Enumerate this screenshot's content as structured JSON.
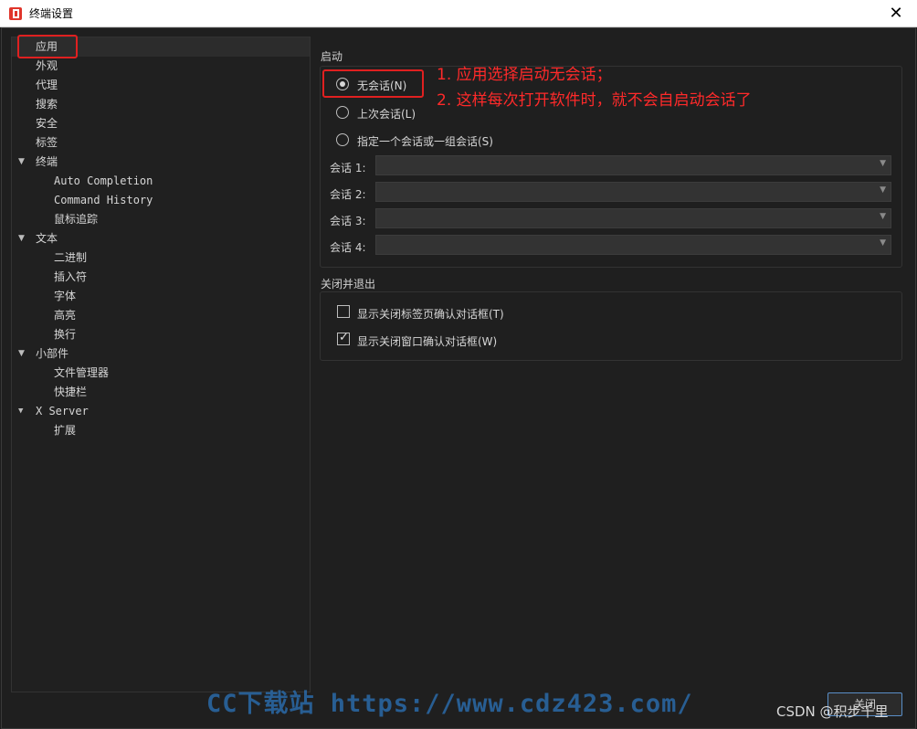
{
  "window": {
    "title": "终端设置",
    "close_glyph": "✕"
  },
  "tree": {
    "items": [
      {
        "label": "应用"
      },
      {
        "label": "外观"
      },
      {
        "label": "代理"
      },
      {
        "label": "搜索"
      },
      {
        "label": "安全"
      },
      {
        "label": "标签"
      },
      {
        "label": "终端"
      },
      {
        "label": "Auto Completion"
      },
      {
        "label": "Command History"
      },
      {
        "label": "鼠标追踪"
      },
      {
        "label": "文本"
      },
      {
        "label": "二进制"
      },
      {
        "label": "插入符"
      },
      {
        "label": "字体"
      },
      {
        "label": "高亮"
      },
      {
        "label": "换行"
      },
      {
        "label": "小部件"
      },
      {
        "label": "文件管理器"
      },
      {
        "label": "快捷栏"
      },
      {
        "label": "X Server"
      },
      {
        "label": "扩展"
      }
    ]
  },
  "startup": {
    "title": "启动",
    "options": [
      {
        "label": "无会话(N)",
        "selected": true
      },
      {
        "label": "上次会话(L)",
        "selected": false
      },
      {
        "label": "指定一个会话或一组会话(S)",
        "selected": false
      }
    ],
    "sessions": [
      {
        "label": "会话 1:",
        "value": ""
      },
      {
        "label": "会话 2:",
        "value": ""
      },
      {
        "label": "会话 3:",
        "value": ""
      },
      {
        "label": "会话 4:",
        "value": ""
      }
    ]
  },
  "close_exit": {
    "title": "关闭并退出",
    "options": [
      {
        "label": "显示关闭标签页确认对话框(T)",
        "checked": false
      },
      {
        "label": "显示关闭窗口确认对话框(W)",
        "checked": true
      }
    ]
  },
  "annotations": {
    "line1": "1. 应用选择启动无会话；",
    "line2": "2. 这样每次打开软件时，就不会自启动会话了",
    "color": "#ff2a2a"
  },
  "footer": {
    "ok_label": "关闭",
    "watermark": "CC下载站 https://www.cdz423.com/",
    "credit": "CSDN @积步千里"
  },
  "colors": {
    "accent": "#5a8fc8",
    "annotation_red": "#e02020"
  },
  "icons": {
    "app": "app-logo-icon",
    "close": "close-icon",
    "expand": "chevron-down-icon",
    "combo": "chevron-down-icon"
  }
}
